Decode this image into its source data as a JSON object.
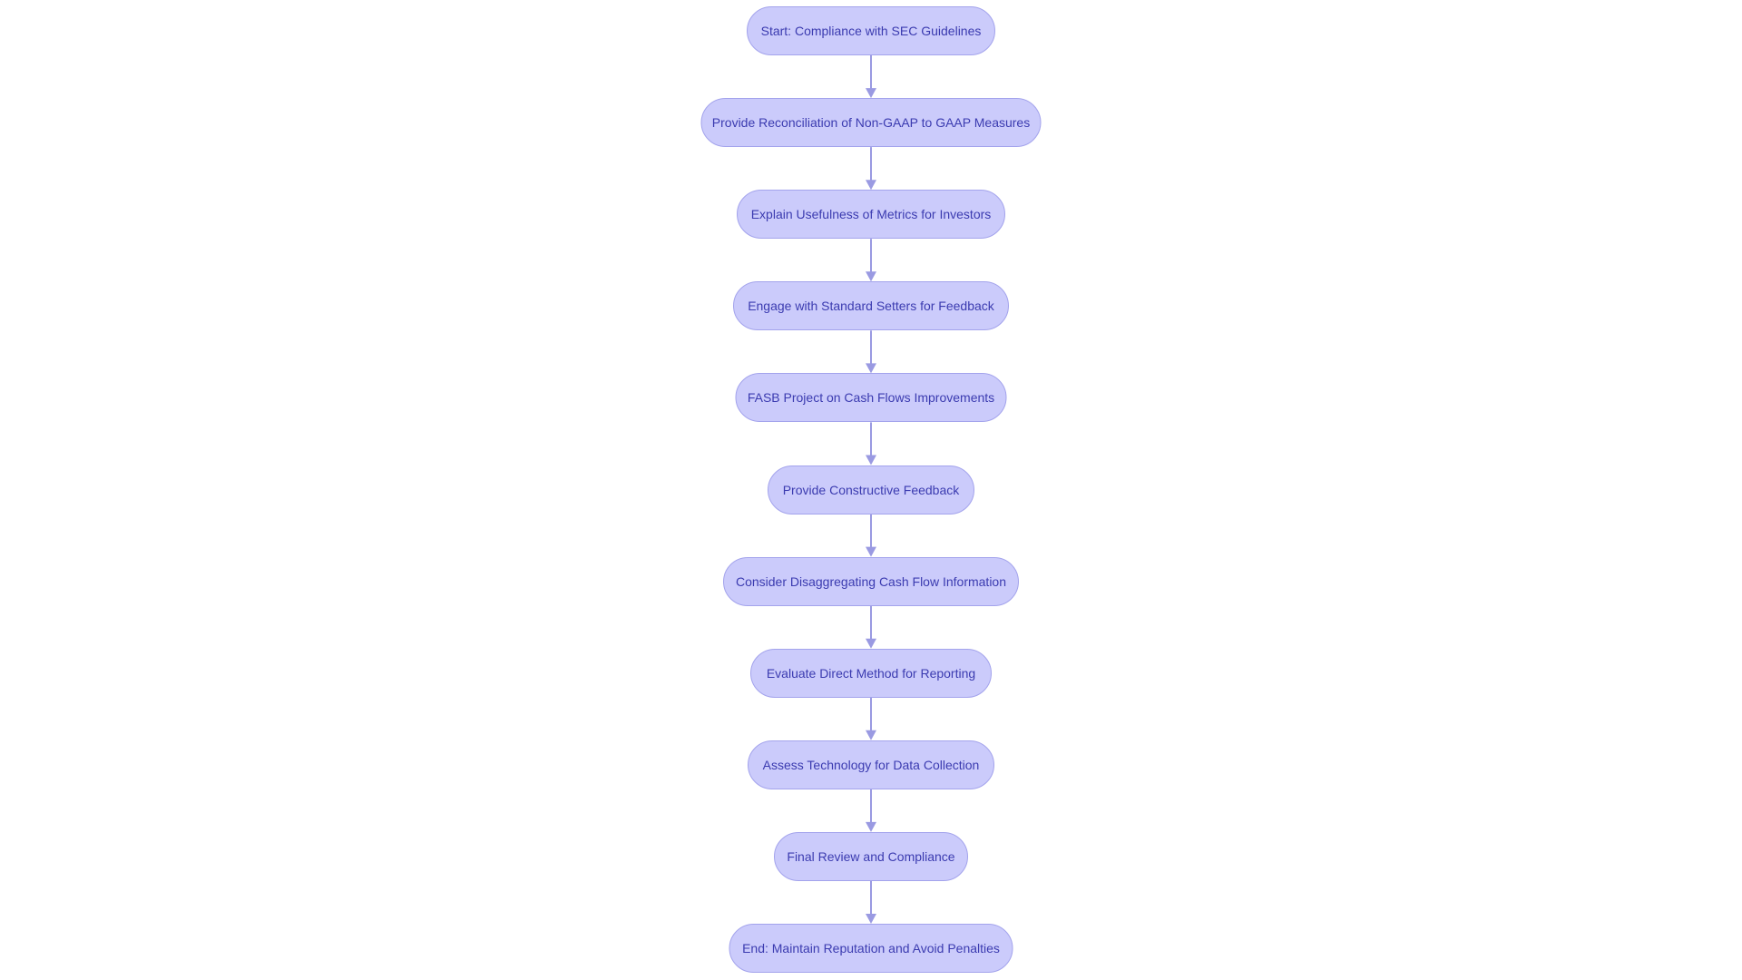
{
  "colors": {
    "node_fill": "#cbcbfb",
    "node_border": "#a3a3ec",
    "text": "#3b3bb0",
    "edge": "#9a9ae2"
  },
  "nodes": [
    {
      "label": "Start: Compliance with SEC Guidelines"
    },
    {
      "label": "Provide Reconciliation of Non-GAAP to GAAP Measures"
    },
    {
      "label": "Explain Usefulness of Metrics for Investors"
    },
    {
      "label": "Engage with Standard Setters for Feedback"
    },
    {
      "label": "FASB Project on Cash Flows Improvements"
    },
    {
      "label": "Provide Constructive Feedback"
    },
    {
      "label": "Consider Disaggregating Cash Flow Information"
    },
    {
      "label": "Evaluate Direct Method for Reporting"
    },
    {
      "label": "Assess Technology for Data Collection"
    },
    {
      "label": "Final Review and Compliance"
    },
    {
      "label": "End: Maintain Reputation and Avoid Penalties"
    }
  ]
}
